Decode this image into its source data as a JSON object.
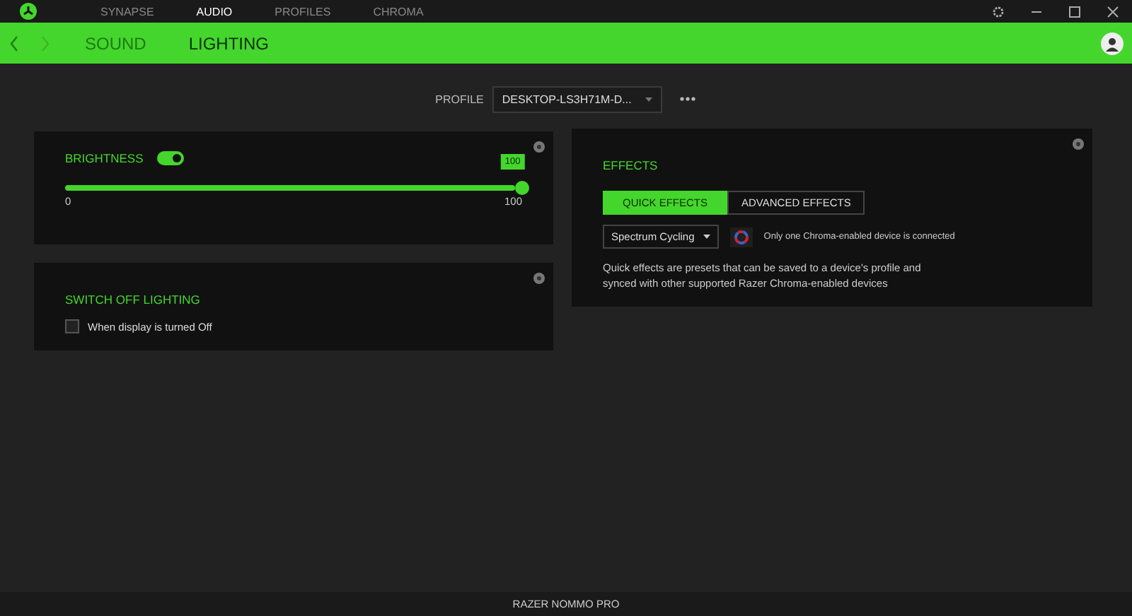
{
  "nav_tabs": [
    {
      "label": "SYNAPSE",
      "selected": false
    },
    {
      "label": "AUDIO",
      "selected": true
    },
    {
      "label": "PROFILES",
      "selected": false
    },
    {
      "label": "CHROMA",
      "selected": false
    }
  ],
  "sub_tabs": [
    {
      "label": "SOUND",
      "selected": false
    },
    {
      "label": "LIGHTING",
      "selected": true
    }
  ],
  "profile": {
    "label": "PROFILE",
    "value": "DESKTOP-LS3H71M-D..."
  },
  "brightness": {
    "title": "BRIGHTNESS",
    "on": true,
    "level": 1,
    "reading": "100",
    "min_label": "0",
    "max_label": "100"
  },
  "switch_off": {
    "title": "SWITCH OFF LIGHTING",
    "option": {
      "label": "When display is turned Off",
      "checked": false
    }
  },
  "effects": {
    "title": "EFFECTS",
    "tabs": [
      {
        "label": "QUICK EFFECTS",
        "selected": true
      },
      {
        "label": "ADVANCED EFFECTS",
        "selected": false
      }
    ],
    "effect": "Spectrum Cycling",
    "note": "Only one Chroma-enabled device is connected",
    "description": "Quick effects are presets that can be saved to a device's profile and synced with other supported Razer Chroma-enabled devices"
  },
  "status_bar": "RAZER NOMMO PRO"
}
